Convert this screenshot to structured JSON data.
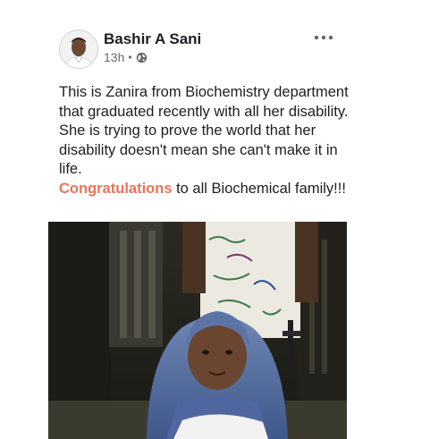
{
  "author": {
    "name": "Bashir A Sani",
    "time": "13h",
    "separator": "•",
    "privacy_icon": "globe-icon",
    "avatar_icon": "avatar"
  },
  "menu": {
    "icon": "more-options-icon"
  },
  "post": {
    "text": "This is Zanira from Biochemistry department that graduated recently with all her disability. She is trying to prove the world that her disability doesn't mean she can't make it in  life.",
    "highlight": "Congratulations",
    "text_after_highlight": " to all Biochemical family!!!"
  },
  "colors": {
    "highlight": "#e9735a",
    "meta": "#65676b",
    "text": "#1c1e21"
  }
}
